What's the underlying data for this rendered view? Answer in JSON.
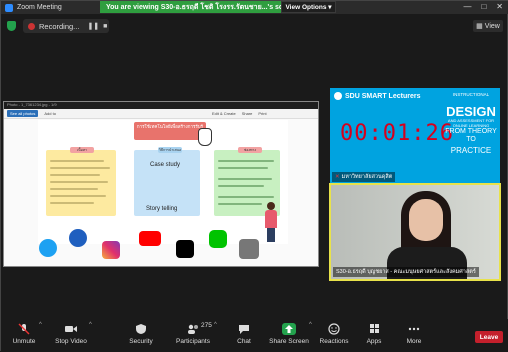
{
  "window": {
    "title": "Zoom Meeting",
    "controls": [
      "—",
      "□",
      "✕"
    ]
  },
  "banner": {
    "text": "You are viewing S30-อ.ธรฤดี โชติ โรงรร.รัตนชาย...'s screen",
    "view_options": "View Options ▾"
  },
  "status": {
    "recording": "Recording...",
    "pause": "❚❚",
    "stop": "■",
    "view": "View"
  },
  "shared_screen": {
    "file_title": "Photo - 1_7361234.jpg - 1/9",
    "toolbar": [
      "See all photos",
      "Add to",
      "Edit & Create",
      "Share",
      "Print"
    ],
    "slide_title": "การใช้เทคโนโลยีเพื่อสร้างการรับรู้",
    "case_study": "Case study",
    "story_telling": "Story telling",
    "card_labels": [
      "เนื้อหา",
      "วิธีการนำเสนอ",
      "ช่องทาง"
    ]
  },
  "timer_tile": {
    "header": "SDU SMART Lecturers",
    "time": "00:01:26",
    "instructional": "INSTRUCTIONAL",
    "design": "DESIGN",
    "assessment": "AND ASSESSMENT FOR ONLINE LEARNING",
    "theory": "FROM THEORY TO",
    "practice": "PRACTICE",
    "name": "มหาวิทยาลัยสวนดุสิต"
  },
  "camera_tile": {
    "name": "S30-อ.ธรฤดี บุญชยาส - คณะมนุษยศาสตร์และสังคมศาสตร์"
  },
  "toolbar": {
    "unmute": "Unmute",
    "stop_video": "Stop Video",
    "security": "Security",
    "participants": "Participants",
    "participants_count": "275",
    "chat": "Chat",
    "share_screen": "Share Screen",
    "reactions": "Reactions",
    "apps": "Apps",
    "more": "More",
    "leave": "Leave"
  }
}
